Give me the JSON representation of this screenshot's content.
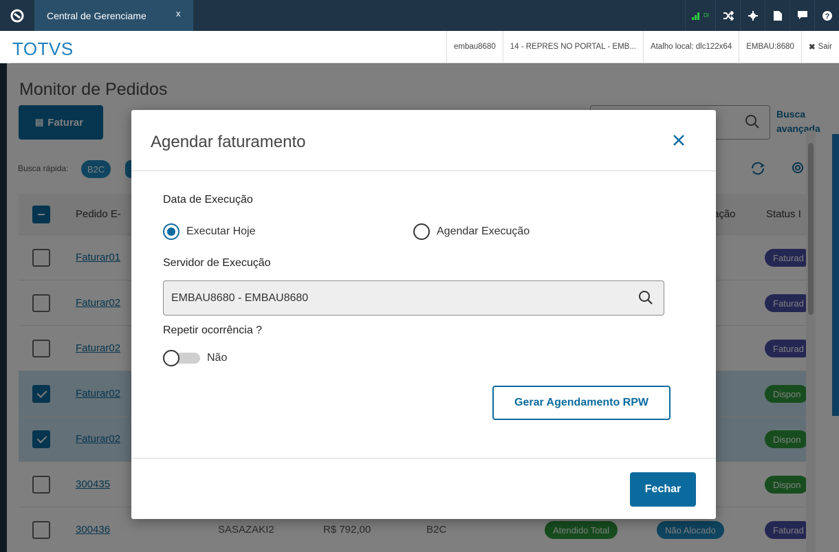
{
  "topbar": {
    "tab_label": "Central de Gerenciame",
    "tab_close": "x",
    "signal_label": "DI"
  },
  "brandbar": {
    "brand": "TOTVS",
    "user": "embau8680",
    "portal": "14 - REPRES NO PORTAL - EMB...",
    "atalho": "Atalho local: dlc122x64",
    "server": "EMBAU:8680",
    "sair": "Sair"
  },
  "page": {
    "title": "Monitor de Pedidos",
    "faturar_label": "Faturar",
    "busca_avancada_1": "Busca",
    "busca_avancada_2": "avançada",
    "busca_rapida": "Busca rápida:",
    "chip_b2c": "B2C",
    "headers": {
      "pedido": "Pedido E-",
      "alocacao": "ação",
      "status": "Status I"
    },
    "rows": [
      {
        "pedido": "Faturar01",
        "status": "Faturad",
        "selected": false
      },
      {
        "pedido": "Faturar02",
        "status": "Faturad",
        "selected": false
      },
      {
        "pedido": "Faturar02",
        "status": "Faturad",
        "selected": false
      },
      {
        "pedido": "Faturar02",
        "status": "Dispon",
        "selected": true
      },
      {
        "pedido": "Faturar02",
        "status": "Dispon",
        "selected": true
      },
      {
        "pedido": "300435",
        "status": "Dispon",
        "selected": false
      },
      {
        "pedido": "300436",
        "cliente": "SASAZAKI2",
        "valor": "R$ 792,00",
        "tipo": "B2C",
        "atend": "Atendido Total",
        "aloc": "Não Alocado",
        "status": "Faturad",
        "selected": false
      }
    ]
  },
  "modal": {
    "title": "Agendar faturamento",
    "data_execucao_label": "Data de Execução",
    "radio_hoje": "Executar Hoje",
    "radio_agendar": "Agendar Execução",
    "servidor_label": "Servidor de Execução",
    "servidor_value": "EMBAU8680 - EMBAU8680",
    "repetir_label": "Repetir ocorrência ?",
    "toggle_label": "Não",
    "rpw_button": "Gerar Agendamento RPW",
    "fechar_button": "Fechar"
  },
  "colors": {
    "primary": "#0c6b9e",
    "brand": "#1f7fc0",
    "topbar": "#1f3446"
  }
}
